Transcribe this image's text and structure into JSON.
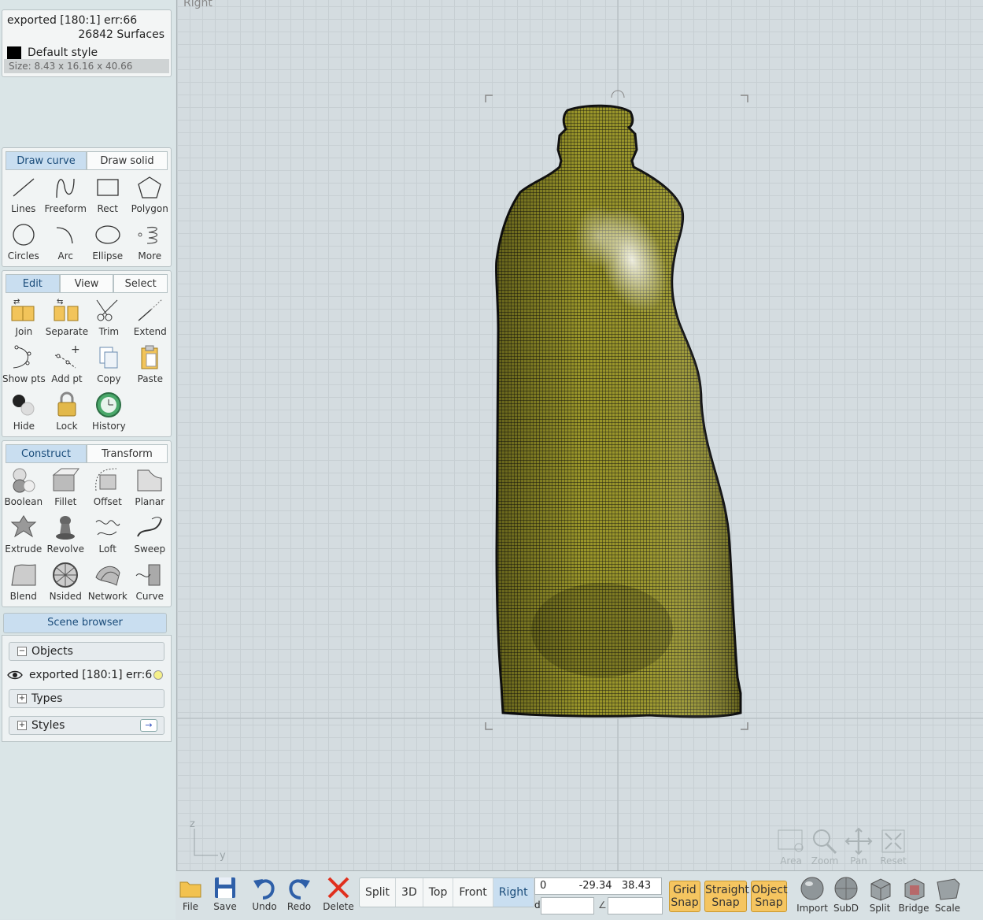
{
  "info": {
    "title": "exported [180:1] err:66",
    "surfaces": "26842 Surfaces",
    "style": "Default style",
    "size": "Size: 8.43 x 16.16 x 40.66"
  },
  "draw": {
    "tabs": [
      "Draw curve",
      "Draw solid"
    ],
    "tools": [
      "Lines",
      "Freeform",
      "Rect",
      "Polygon",
      "Circles",
      "Arc",
      "Ellipse",
      "More"
    ]
  },
  "edit": {
    "tabs": [
      "Edit",
      "View",
      "Select"
    ],
    "tools": [
      "Join",
      "Separate",
      "Trim",
      "Extend",
      "Show pts",
      "Add pt",
      "Copy",
      "Paste",
      "Hide",
      "Lock",
      "History"
    ]
  },
  "construct": {
    "tabs": [
      "Construct",
      "Transform"
    ],
    "tools": [
      "Boolean",
      "Fillet",
      "Offset",
      "Planar",
      "Extrude",
      "Revolve",
      "Loft",
      "Sweep",
      "Blend",
      "Nsided",
      "Network",
      "Curve"
    ]
  },
  "scene": {
    "title": "Scene browser",
    "objects_label": "Objects",
    "object_item": "exported [180:1] err:6",
    "types_label": "Types",
    "styles_label": "Styles"
  },
  "viewport": {
    "label": "Right",
    "axis_z": "z",
    "axis_y": "y",
    "nav": [
      "Area",
      "Zoom",
      "Pan",
      "Reset"
    ]
  },
  "bottom": {
    "file": "File",
    "save": "Save",
    "undo": "Undo",
    "redo": "Redo",
    "delete": "Delete",
    "views": [
      "Split",
      "3D",
      "Top",
      "Front",
      "Right"
    ],
    "active_view": "Right",
    "coords": "0          -29.34   38.43",
    "d_label": "d",
    "angle_label": "∠",
    "grid_snap": [
      "Grid",
      "Snap"
    ],
    "straight_snap": [
      "Straight",
      "Snap"
    ],
    "object_snap": [
      "Object",
      "Snap"
    ],
    "import": "Import",
    "subd": "SubD",
    "split": "Split",
    "bridge": "Bridge",
    "scale": "Scale"
  },
  "colors": {
    "accent": "#c9def0",
    "snap": "#f5c560",
    "model": "#8a8a1f"
  }
}
